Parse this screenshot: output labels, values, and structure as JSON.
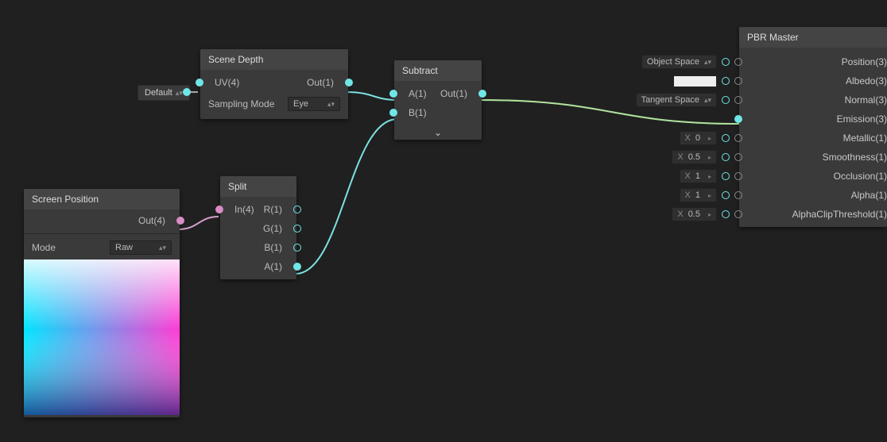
{
  "nodes": {
    "sceneDepth": {
      "title": "Scene Depth",
      "in_uv": "UV(4)",
      "out": "Out(1)",
      "mode_label": "Sampling Mode",
      "mode_value": "Eye"
    },
    "default_pill": {
      "label": "Default"
    },
    "subtract": {
      "title": "Subtract",
      "in_a": "A(1)",
      "in_b": "B(1)",
      "out": "Out(1)"
    },
    "screenPos": {
      "title": "Screen Position",
      "out": "Out(4)",
      "mode_label": "Mode",
      "mode_value": "Raw"
    },
    "split": {
      "title": "Split",
      "in": "In(4)",
      "out_r": "R(1)",
      "out_g": "G(1)",
      "out_b": "B(1)",
      "out_a": "A(1)"
    },
    "pbr": {
      "title": "PBR Master",
      "position": "Position(3)",
      "albedo": "Albedo(3)",
      "normal": "Normal(3)",
      "emission": "Emission(3)",
      "metallic": "Metallic(1)",
      "smoothness": "Smoothness(1)",
      "occlusion": "Occlusion(1)",
      "alpha": "Alpha(1)",
      "alphaclip": "AlphaClipThreshold(1)",
      "pos_space": "Object Space",
      "normal_space": "Tangent Space",
      "metallic_v": "0",
      "smoothness_v": "0.5",
      "occlusion_v": "1",
      "alpha_v": "1",
      "alphaclip_v": "0.5",
      "x_label": "X"
    }
  }
}
